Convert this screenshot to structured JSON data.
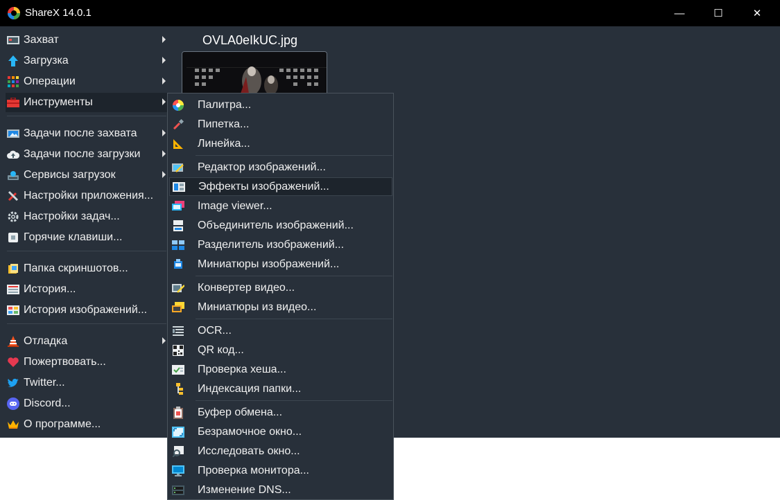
{
  "window": {
    "title": "ShareX 14.0.1",
    "minimize": "—",
    "maximize": "☐",
    "close": "✕"
  },
  "preview": {
    "filename": "OVLA0eIkUC.jpg"
  },
  "main_menu": [
    {
      "label": "Захват",
      "icon": "capture-icon",
      "submenu": true
    },
    {
      "label": "Загрузка",
      "icon": "upload-arrow-icon",
      "submenu": true
    },
    {
      "label": "Операции",
      "icon": "workflows-icon",
      "submenu": true
    },
    {
      "label": "Инструменты",
      "icon": "toolbox-icon",
      "submenu": true,
      "active": true
    },
    {
      "label": "Задачи после захвата",
      "icon": "after-capture-icon",
      "submenu": true
    },
    {
      "label": "Задачи после загрузки",
      "icon": "after-upload-cloud-icon",
      "submenu": true
    },
    {
      "label": "Сервисы загрузок",
      "icon": "destinations-icon",
      "submenu": true
    },
    {
      "label": "Настройки приложения...",
      "icon": "app-settings-icon",
      "submenu": false
    },
    {
      "label": "Настройки задач...",
      "icon": "task-settings-gear-icon",
      "submenu": false
    },
    {
      "label": "Горячие клавиши...",
      "icon": "hotkeys-icon",
      "submenu": false
    },
    {
      "label": "Папка скриншотов...",
      "icon": "screenshots-folder-icon",
      "submenu": false
    },
    {
      "label": "История...",
      "icon": "history-icon",
      "submenu": false
    },
    {
      "label": "История изображений...",
      "icon": "image-history-icon",
      "submenu": false
    },
    {
      "label": "Отладка",
      "icon": "debug-cone-icon",
      "submenu": true
    },
    {
      "label": "Пожертвовать...",
      "icon": "heart-icon",
      "submenu": false
    },
    {
      "label": "Twitter...",
      "icon": "twitter-icon",
      "submenu": false
    },
    {
      "label": "Discord...",
      "icon": "discord-icon",
      "submenu": false
    },
    {
      "label": "О программе...",
      "icon": "crown-icon",
      "submenu": false
    }
  ],
  "tools_submenu": [
    {
      "label": "Палитра...",
      "icon": "color-wheel-icon"
    },
    {
      "label": "Пипетка...",
      "icon": "eyedropper-icon"
    },
    {
      "label": "Линейка...",
      "icon": "ruler-icon"
    },
    {
      "label": "Редактор изображений...",
      "icon": "image-editor-icon"
    },
    {
      "label": "Эффекты изображений...",
      "icon": "image-effects-icon",
      "highlighted": true
    },
    {
      "label": "Image viewer...",
      "icon": "image-viewer-icon"
    },
    {
      "label": "Объединитель изображений...",
      "icon": "image-combiner-icon"
    },
    {
      "label": "Разделитель изображений...",
      "icon": "image-splitter-icon"
    },
    {
      "label": "Миниатюры изображений...",
      "icon": "image-thumbnailer-icon"
    },
    {
      "label": "Конвертер видео...",
      "icon": "video-converter-icon"
    },
    {
      "label": "Миниатюры из видео...",
      "icon": "video-thumbnailer-icon"
    },
    {
      "label": "OCR...",
      "icon": "ocr-icon"
    },
    {
      "label": "QR код...",
      "icon": "qr-code-icon"
    },
    {
      "label": "Проверка хеша...",
      "icon": "hash-check-icon"
    },
    {
      "label": "Индексация папки...",
      "icon": "directory-indexer-icon"
    },
    {
      "label": "Буфер обмена...",
      "icon": "clipboard-icon"
    },
    {
      "label": "Безрамочное окно...",
      "icon": "borderless-window-icon"
    },
    {
      "label": "Исследовать окно...",
      "icon": "inspect-window-icon"
    },
    {
      "label": "Проверка монитора...",
      "icon": "monitor-test-icon"
    },
    {
      "label": "Изменение DNS...",
      "icon": "dns-changer-icon"
    }
  ],
  "colors": {
    "background": "#28303a",
    "titlebar": "#000000",
    "hover": "#1d242c",
    "separator": "#3d4650"
  }
}
